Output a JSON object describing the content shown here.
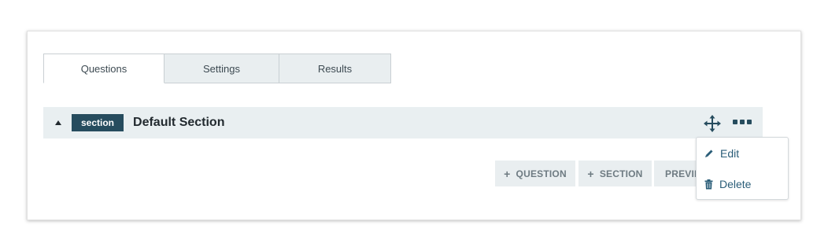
{
  "tabs": [
    {
      "label": "Questions",
      "active": true
    },
    {
      "label": "Settings",
      "active": false
    },
    {
      "label": "Results",
      "active": false
    }
  ],
  "section": {
    "badge": "section",
    "title": "Default Section",
    "icons": {
      "collapse": "caret-up-icon",
      "move": "move-arrows-icon",
      "more": "more-dots-icon"
    }
  },
  "actions": {
    "question_label": "QUESTION",
    "section_label": "SECTION",
    "preview_label": "PREVIEW"
  },
  "menu": {
    "edit_label": "Edit",
    "delete_label": "Delete"
  },
  "colors": {
    "accent": "#264c5e",
    "link": "#2a5d78",
    "bar_bg": "#e9eff1"
  }
}
